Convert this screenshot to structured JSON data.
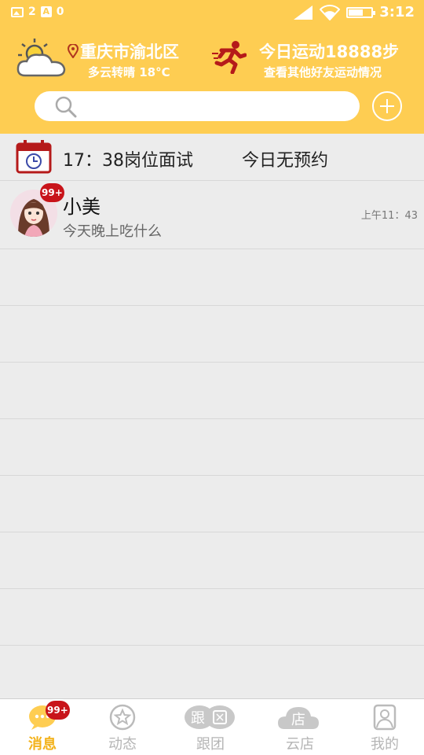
{
  "status_bar": {
    "left_count": "2",
    "a_label": "A",
    "a_count": "0",
    "time": "3:12"
  },
  "header": {
    "location": "重庆市渝北区",
    "weather": "多云转晴  18°C",
    "steps_title": "今日运动18888步",
    "steps_subtitle": "查看其他好友运动情况",
    "search_placeholder": ""
  },
  "schedule": {
    "item": "17：38岗位面试",
    "status": "今日无预约"
  },
  "chats": [
    {
      "name": "小美",
      "message": "今天晚上吃什么",
      "time": "上午11：43",
      "badge": "99+"
    }
  ],
  "tabs": [
    {
      "label": "消息",
      "icon": "message-icon",
      "badge": "99+",
      "active": true
    },
    {
      "label": "动态",
      "icon": "star-icon"
    },
    {
      "label": "跟团",
      "icon": "group-icon",
      "icon_text": "跟"
    },
    {
      "label": "云店",
      "icon": "cloud-store-icon",
      "icon_text": "店"
    },
    {
      "label": "我的",
      "icon": "profile-icon"
    }
  ],
  "colors": {
    "header_bg": "#fecd52",
    "badge_red": "#c8141a",
    "active_tab": "#f3b21a",
    "list_bg": "#ececec"
  }
}
